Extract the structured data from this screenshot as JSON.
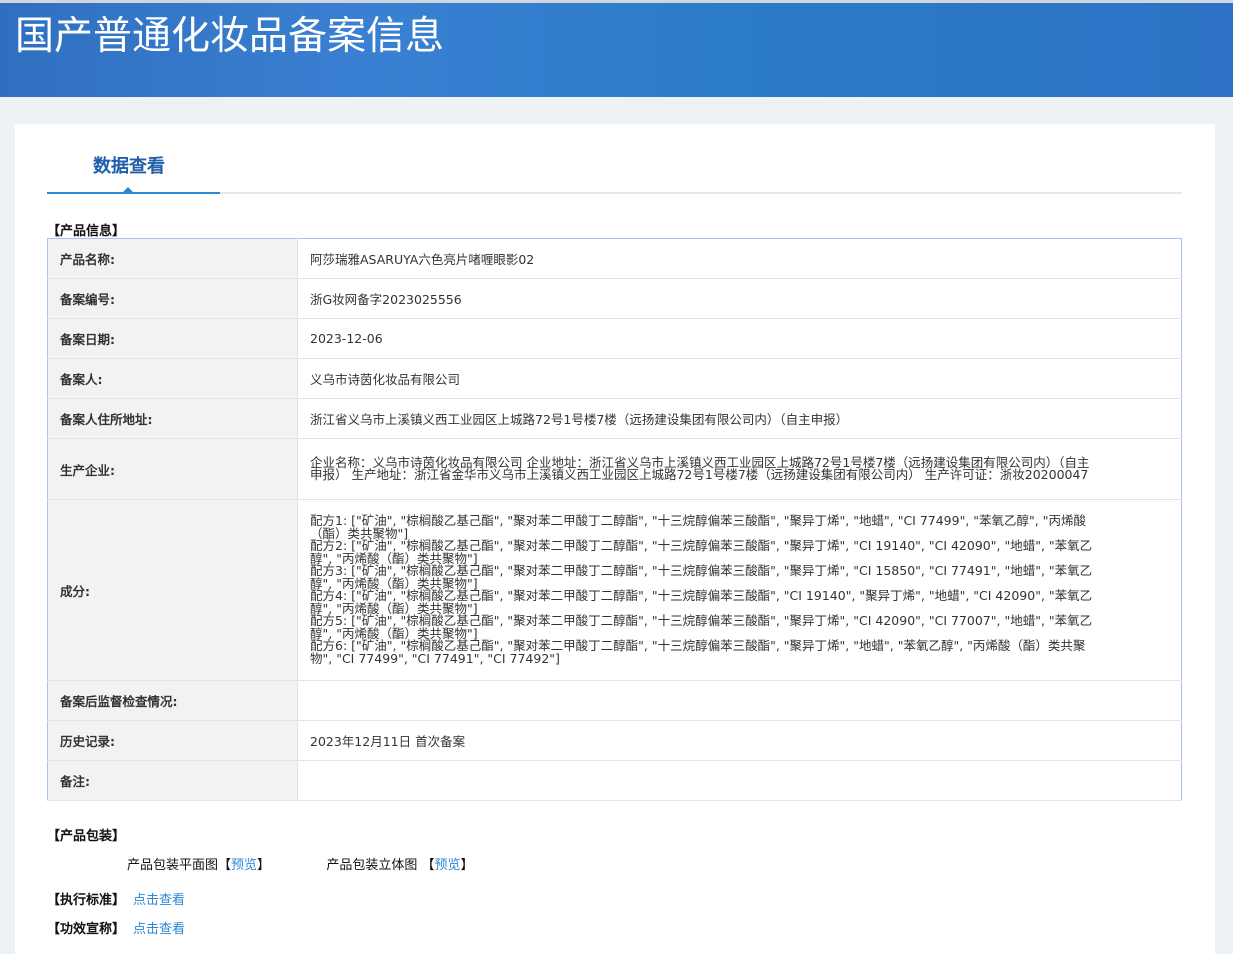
{
  "header": {
    "title": "国产普通化妆品备案信息"
  },
  "tab": {
    "label": "数据查看"
  },
  "sections": {
    "product_info": "【产品信息】",
    "packaging": "【产品包装】",
    "standard": "【执行标准】",
    "efficacy": "【功效宣称】"
  },
  "rows": [
    {
      "label": "产品名称:",
      "value": "阿莎瑞雅ASARUYA六色亮片啫喱眼影02"
    },
    {
      "label": "备案编号:",
      "value": "浙G妆网备字2023025556"
    },
    {
      "label": "备案日期:",
      "value": "2023-12-06"
    },
    {
      "label": "备案人:",
      "value": "义乌市诗茵化妆品有限公司"
    },
    {
      "label": "备案人住所地址:",
      "value": "浙江省义乌市上溪镇义西工业园区上城路72号1号楼7楼（远扬建设集团有限公司内）（自主申报）"
    },
    {
      "label": "生产企业:",
      "value": "企业名称：义乌市诗茵化妆品有限公司 企业地址：浙江省义乌市上溪镇义西工业园区上城路72号1号楼7楼（远扬建设集团有限公司内）（自主申报） 生产地址：浙江省金华市义乌市上溪镇义西工业园区上城路72号1号楼7楼（远扬建设集团有限公司内） 生产许可证：浙妆20200047"
    },
    {
      "label": "成分:"
    },
    {
      "label": "备案后监督检查情况:",
      "value": ""
    },
    {
      "label": "历史记录:",
      "value": "2023年12月11日 首次备案"
    },
    {
      "label": "备注:",
      "value": ""
    }
  ],
  "ingredients": [
    "配方1: [\"矿油\", \"棕榈酸乙基己酯\", \"聚对苯二甲酸丁二醇酯\", \"十三烷醇偏苯三酸酯\", \"聚异丁烯\", \"地蜡\", \"CI 77499\", \"苯氧乙醇\", \"丙烯酸（酯）类共聚物\"]",
    "配方2: [\"矿油\", \"棕榈酸乙基己酯\", \"聚对苯二甲酸丁二醇酯\", \"十三烷醇偏苯三酸酯\", \"聚异丁烯\", \"CI 19140\", \"CI 42090\", \"地蜡\", \"苯氧乙醇\", \"丙烯酸（酯）类共聚物\"]",
    "配方3: [\"矿油\", \"棕榈酸乙基己酯\", \"聚对苯二甲酸丁二醇酯\", \"十三烷醇偏苯三酸酯\", \"聚异丁烯\", \"CI 15850\", \"CI 77491\", \"地蜡\", \"苯氧乙醇\", \"丙烯酸（酯）类共聚物\"]",
    "配方4: [\"矿油\", \"棕榈酸乙基己酯\", \"聚对苯二甲酸丁二醇酯\", \"十三烷醇偏苯三酸酯\", \"CI 19140\", \"聚异丁烯\", \"地蜡\", \"CI 42090\", \"苯氧乙醇\", \"丙烯酸（酯）类共聚物\"]",
    "配方5: [\"矿油\", \"棕榈酸乙基己酯\", \"聚对苯二甲酸丁二醇酯\", \"十三烷醇偏苯三酸酯\", \"聚异丁烯\", \"CI 42090\", \"CI 77007\", \"地蜡\", \"苯氧乙醇\", \"丙烯酸（酯）类共聚物\"]",
    "配方6: [\"矿油\", \"棕榈酸乙基己酯\", \"聚对苯二甲酸丁二醇酯\", \"十三烷醇偏苯三酸酯\", \"聚异丁烯\", \"地蜡\", \"苯氧乙醇\", \"丙烯酸（酯）类共聚物\", \"CI 77499\", \"CI 77491\", \"CI 77492\"]"
  ],
  "packaging": {
    "flat_label": "产品包装平面图",
    "solid_label": "产品包装立体图",
    "preview": "预览",
    "bracket_open": "【",
    "bracket_close": "】"
  },
  "links": {
    "view": "点击查看"
  }
}
